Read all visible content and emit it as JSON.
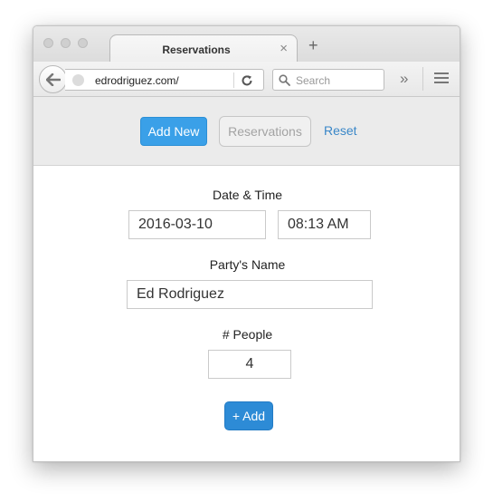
{
  "browser": {
    "tab_title": "Reservations",
    "tab_close": "×",
    "new_tab": "+",
    "url": "edrodriguez.com/",
    "search_placeholder": "Search",
    "overflow": "»"
  },
  "header": {
    "add_new_label": "Add New",
    "reservations_label": "Reservations",
    "reset_label": "Reset"
  },
  "form": {
    "datetime_label": "Date & Time",
    "date_value": "2016-03-10",
    "time_value": "08:13 AM",
    "name_label": "Party's Name",
    "name_value": "Ed Rodriguez",
    "people_label": "# People",
    "people_value": "4",
    "add_button_label": "+ Add"
  },
  "colors": {
    "primary": "#3aa0e8",
    "add_button": "#2d8bd6",
    "link": "#3a87c8"
  },
  "icons": [
    "back-arrow-icon",
    "globe-icon",
    "reload-icon",
    "search-icon",
    "overflow-chevron-icon",
    "hamburger-menu-icon"
  ]
}
